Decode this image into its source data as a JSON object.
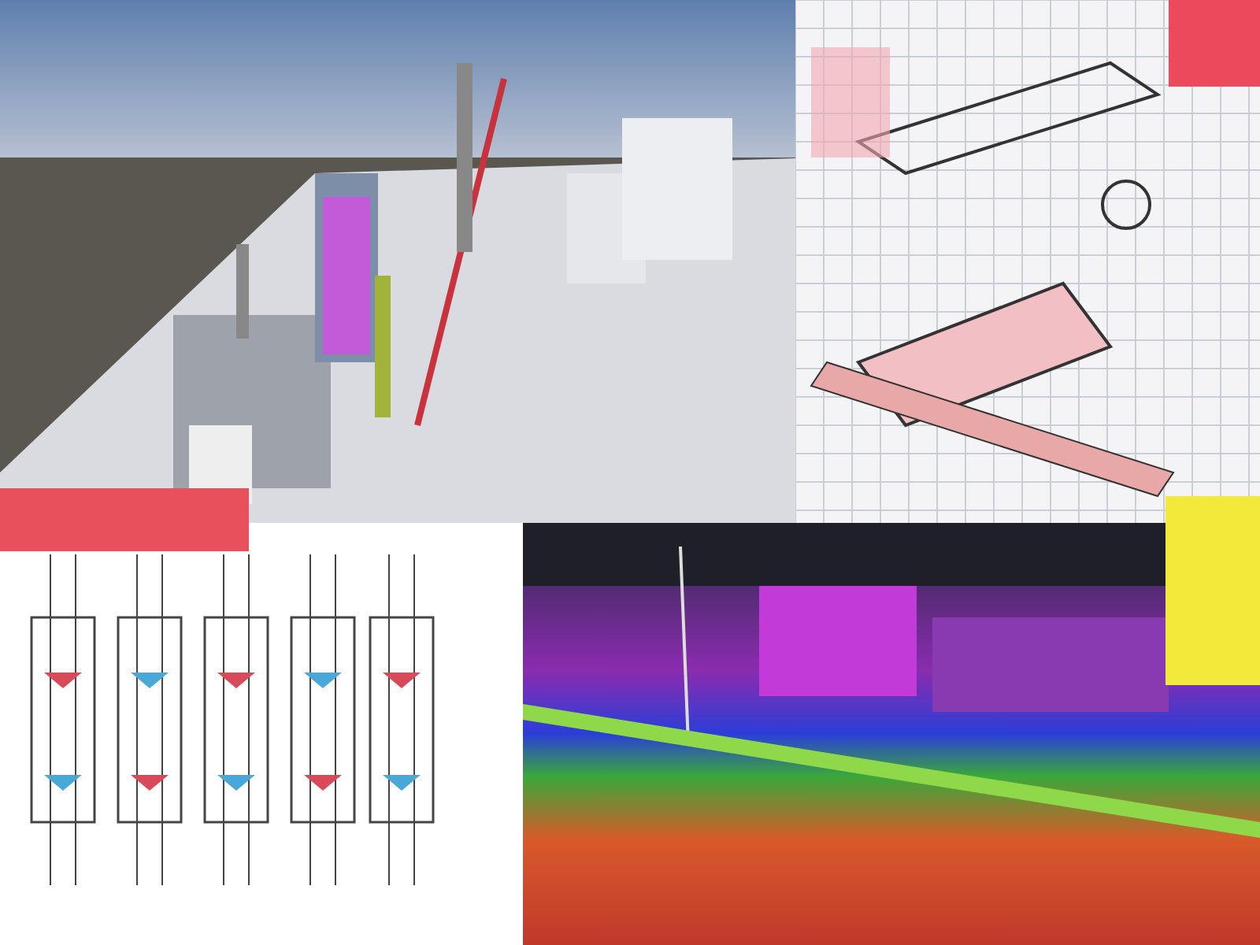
{
  "panels": [
    {
      "kind": "render"
    },
    {
      "kind": "grid-sketch"
    },
    {
      "kind": "line-sketch"
    },
    {
      "kind": "pointcloud"
    }
  ],
  "accents": [
    {
      "color": "#e8505b"
    },
    {
      "color": "#ec4a5c"
    },
    {
      "color": "#f2e93b"
    }
  ]
}
